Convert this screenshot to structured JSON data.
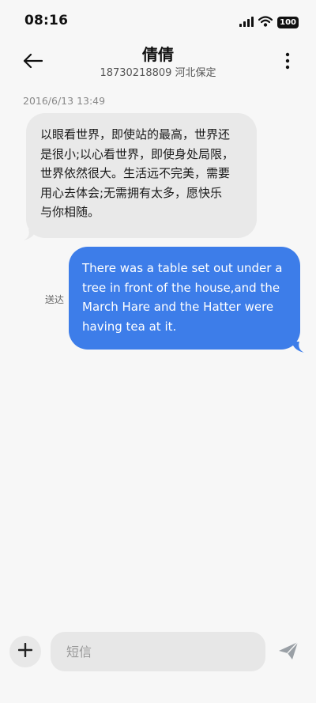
{
  "status_bar": {
    "time": "08:16",
    "battery": "100",
    "icons": [
      "signal-icon",
      "wifi-icon",
      "battery-icon"
    ]
  },
  "header": {
    "contact_name": "倩倩",
    "contact_sub": "18730218809 河北保定",
    "icons": [
      "back-arrow-icon",
      "more-vertical-icon"
    ]
  },
  "conversation": {
    "timestamp": "2016/6/13 13:49",
    "incoming": {
      "lines": [
        "以眼看世界，即使站的最高，世界还",
        "是很小;以心看世界，即使身处局限，",
        "世界依然很大。生活远不完美，需要",
        "用心去体会;无需拥有太多，愿快乐",
        "与你相随。"
      ]
    },
    "outgoing": {
      "lines": [
        "There was a table set out under a",
        "tree in front of the house,and the",
        "March Hare and the Hatter were",
        "having tea at it."
      ],
      "status": "送达"
    }
  },
  "composer": {
    "placeholder": "短信",
    "icons": [
      "plus-icon",
      "send-icon"
    ]
  },
  "colors": {
    "background": "#f7f7f7",
    "incoming_bubble": "#e9e9e9",
    "outgoing_bubble": "#3d7de9",
    "input_background": "#e7e7e7",
    "send_icon": "#9aa0a6"
  }
}
